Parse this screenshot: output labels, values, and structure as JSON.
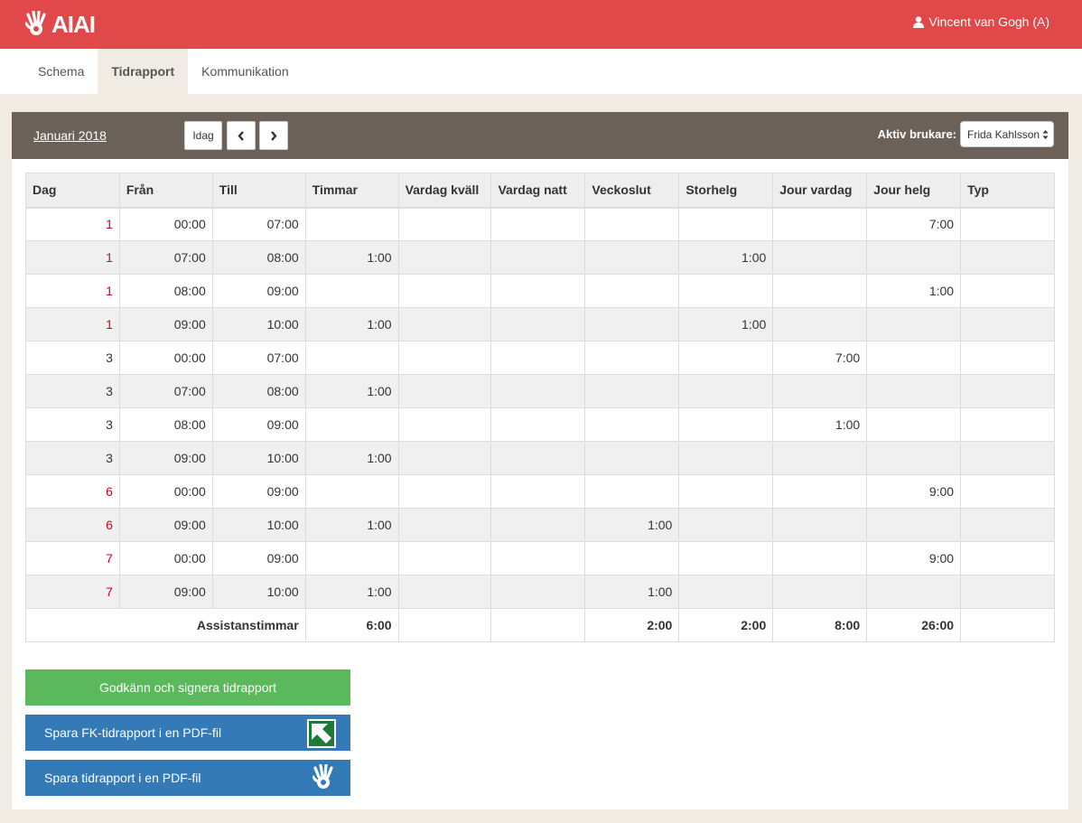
{
  "header": {
    "logo_text": "AIAI",
    "user_name": "Vincent van Gogh (A)",
    "brand_color": "#e0484a"
  },
  "nav": {
    "tabs": [
      {
        "label": "Schema",
        "active": false
      },
      {
        "label": "Tidrapport",
        "active": true
      },
      {
        "label": "Kommunikation",
        "active": false
      }
    ]
  },
  "toolbar": {
    "month_label": "Januari 2018",
    "today_label": "Idag",
    "active_user_label": "Aktiv brukare:",
    "active_user_value": "Frida Kahlsson"
  },
  "table": {
    "headers": [
      "Dag",
      "Från",
      "Till",
      "Timmar",
      "Vardag kväll",
      "Vardag natt",
      "Veckoslut",
      "Storhelg",
      "Jour vardag",
      "Jour helg",
      "Typ"
    ],
    "rows": [
      {
        "day": "1",
        "holiday": true,
        "cells": [
          "1",
          "00:00",
          "07:00",
          "",
          "",
          "",
          "",
          "",
          "",
          "7:00",
          ""
        ]
      },
      {
        "day": "1",
        "holiday": true,
        "cells": [
          "1",
          "07:00",
          "08:00",
          "1:00",
          "",
          "",
          "",
          "1:00",
          "",
          "",
          ""
        ]
      },
      {
        "day": "1",
        "holiday": true,
        "cells": [
          "1",
          "08:00",
          "09:00",
          "",
          "",
          "",
          "",
          "",
          "",
          "1:00",
          ""
        ]
      },
      {
        "day": "1",
        "holiday": true,
        "cells": [
          "1",
          "09:00",
          "10:00",
          "1:00",
          "",
          "",
          "",
          "1:00",
          "",
          "",
          ""
        ]
      },
      {
        "day": "3",
        "holiday": false,
        "cells": [
          "3",
          "00:00",
          "07:00",
          "",
          "",
          "",
          "",
          "",
          "7:00",
          "",
          ""
        ]
      },
      {
        "day": "3",
        "holiday": false,
        "cells": [
          "3",
          "07:00",
          "08:00",
          "1:00",
          "",
          "",
          "",
          "",
          "",
          "",
          ""
        ]
      },
      {
        "day": "3",
        "holiday": false,
        "cells": [
          "3",
          "08:00",
          "09:00",
          "",
          "",
          "",
          "",
          "",
          "1:00",
          "",
          ""
        ]
      },
      {
        "day": "3",
        "holiday": false,
        "cells": [
          "3",
          "09:00",
          "10:00",
          "1:00",
          "",
          "",
          "",
          "",
          "",
          "",
          ""
        ]
      },
      {
        "day": "6",
        "holiday": true,
        "cells": [
          "6",
          "00:00",
          "09:00",
          "",
          "",
          "",
          "",
          "",
          "",
          "9:00",
          ""
        ]
      },
      {
        "day": "6",
        "holiday": true,
        "cells": [
          "6",
          "09:00",
          "10:00",
          "1:00",
          "",
          "",
          "1:00",
          "",
          "",
          "",
          ""
        ]
      },
      {
        "day": "7",
        "holiday": true,
        "cells": [
          "7",
          "00:00",
          "09:00",
          "",
          "",
          "",
          "",
          "",
          "",
          "9:00",
          ""
        ]
      },
      {
        "day": "7",
        "holiday": true,
        "cells": [
          "7",
          "09:00",
          "10:00",
          "1:00",
          "",
          "",
          "1:00",
          "",
          "",
          "",
          ""
        ]
      }
    ],
    "totals": {
      "label": "Assistanstimmar",
      "cells": [
        "6:00",
        "",
        "",
        "2:00",
        "2:00",
        "8:00",
        "26:00",
        ""
      ]
    }
  },
  "actions": {
    "approve_label": "Godkänn och signera tidrapport",
    "fk_pdf_label": "Spara FK-tidrapport i en PDF-fil",
    "pdf_label": "Spara tidrapport i en PDF-fil"
  },
  "colors": {
    "holiday_text": "#d0021b",
    "approve_green": "#5cb85c",
    "action_blue": "#337ab7",
    "panel_header": "#6b6159"
  }
}
